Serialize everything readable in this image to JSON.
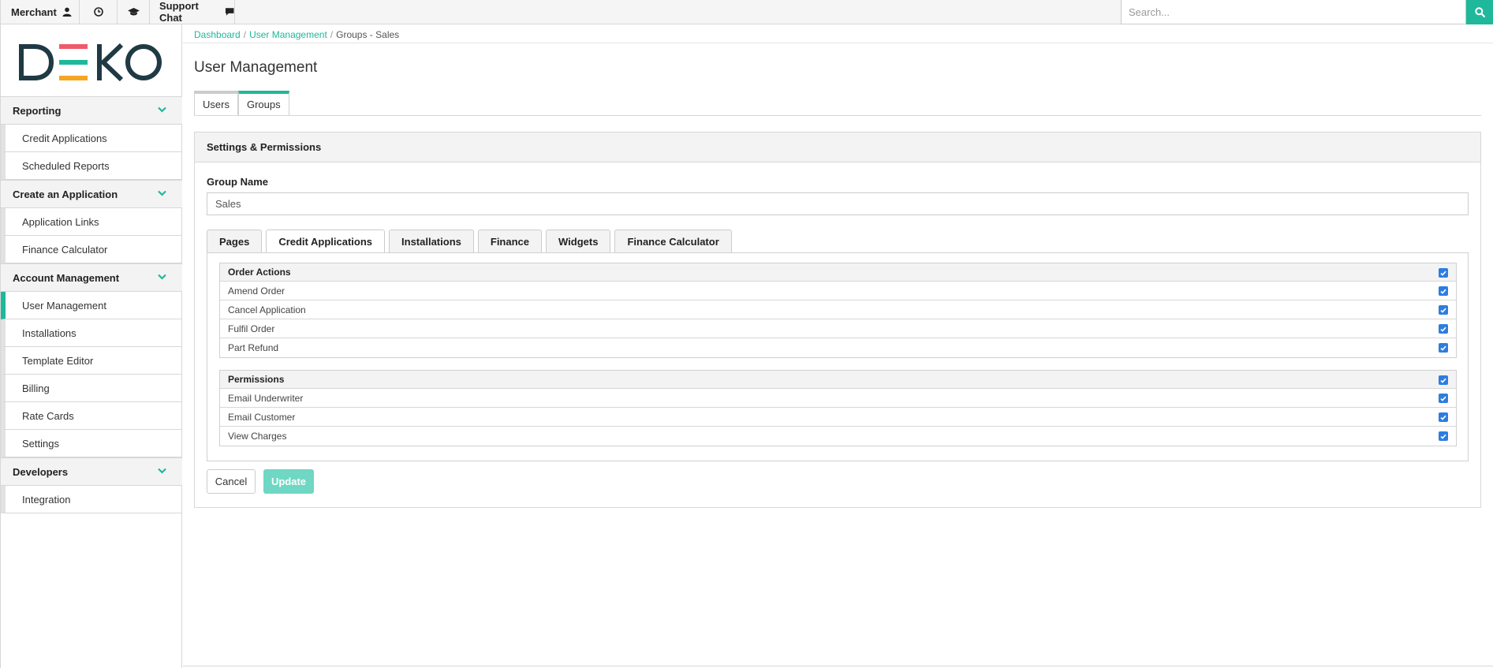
{
  "topbar": {
    "merchant_label": "Merchant",
    "support_label": "Support Chat",
    "search_placeholder": "Search...",
    "icons": [
      "user-icon",
      "clock-icon",
      "graduation-cap-icon",
      "chat-icon",
      "search-icon"
    ]
  },
  "brand": {
    "logo_text": "DEKO",
    "accent": "#1fb89a",
    "logo_colors": [
      "#f0596b",
      "#1fb89a",
      "#f5a623"
    ]
  },
  "sidebar": {
    "sections": [
      {
        "label": "Reporting",
        "items": [
          {
            "label": "Credit Applications"
          },
          {
            "label": "Scheduled Reports"
          }
        ]
      },
      {
        "label": "Create an Application",
        "items": [
          {
            "label": "Application Links"
          },
          {
            "label": "Finance Calculator"
          }
        ]
      },
      {
        "label": "Account Management",
        "items": [
          {
            "label": "User Management",
            "active": true
          },
          {
            "label": "Installations"
          },
          {
            "label": "Template Editor"
          },
          {
            "label": "Billing"
          },
          {
            "label": "Rate Cards"
          },
          {
            "label": "Settings"
          }
        ]
      },
      {
        "label": "Developers",
        "items": [
          {
            "label": "Integration"
          }
        ]
      }
    ]
  },
  "breadcrumb": {
    "items": [
      "Dashboard",
      "User Management"
    ],
    "current": "Groups - Sales",
    "separator": "/"
  },
  "page": {
    "title": "User Management"
  },
  "main_tabs": {
    "users": "Users",
    "groups": "Groups",
    "active": "Groups"
  },
  "panel": {
    "heading": "Settings & Permissions",
    "group_name_label": "Group Name",
    "group_name_value": "Sales"
  },
  "perm_tabs": {
    "items": [
      "Pages",
      "Credit Applications",
      "Installations",
      "Finance",
      "Widgets",
      "Finance Calculator"
    ],
    "active": "Credit Applications"
  },
  "groups": [
    {
      "title": "Order Actions",
      "checked": true,
      "rows": [
        {
          "label": "Amend Order",
          "checked": true
        },
        {
          "label": "Cancel Application",
          "checked": true
        },
        {
          "label": "Fulfil Order",
          "checked": true
        },
        {
          "label": "Part Refund",
          "checked": true
        }
      ]
    },
    {
      "title": "Permissions",
      "checked": true,
      "rows": [
        {
          "label": "Email Underwriter",
          "checked": true
        },
        {
          "label": "Email Customer",
          "checked": true
        },
        {
          "label": "View Charges",
          "checked": true
        }
      ]
    }
  ],
  "buttons": {
    "cancel": "Cancel",
    "update": "Update"
  }
}
